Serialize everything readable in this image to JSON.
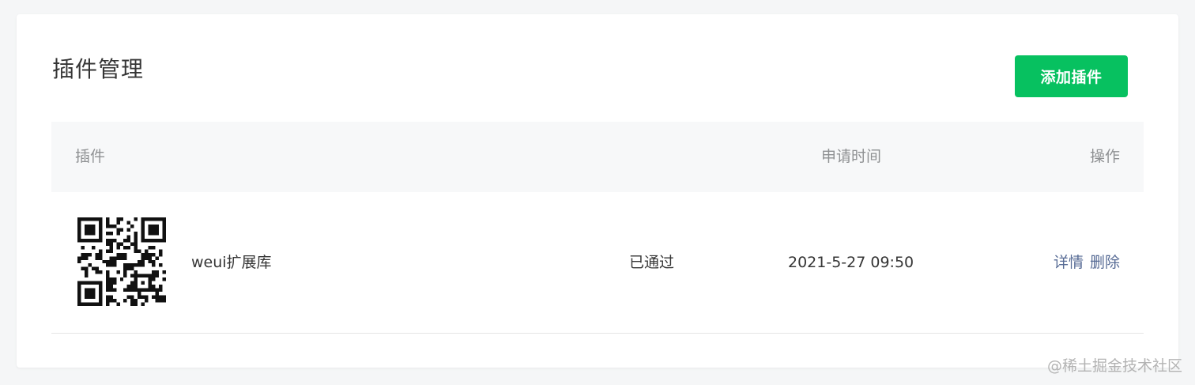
{
  "page": {
    "title": "插件管理",
    "add_button_label": "添加插件"
  },
  "table": {
    "headers": {
      "plugin": "插件",
      "time": "申请时间",
      "ops": "操作"
    },
    "rows": [
      {
        "qr_icon": "qr-code-icon",
        "name": "weui扩展库",
        "status": "已通过",
        "time": "2021-5-27 09:50",
        "actions": [
          "详情",
          "删除"
        ]
      }
    ]
  },
  "watermark": "@稀土掘金技术社区",
  "colors": {
    "accent": "#07c160",
    "link": "#576b95",
    "header_bg": "#f7f8f9",
    "page_bg": "#f5f6f7"
  }
}
